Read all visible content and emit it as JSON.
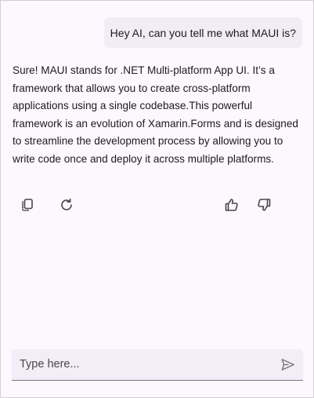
{
  "conversation": {
    "user_message": "Hey AI, can you tell me what MAUI is?",
    "ai_message": "Sure! MAUI stands for .NET Multi-platform App UI. It’s a framework that allows you to create cross-platform applications using a single codebase.This powerful framework is an evolution of Xamarin.Forms and is designed to streamline the development process by allowing you to write code once and deploy it across multiple platforms."
  },
  "actions": {
    "icons": [
      "copy-icon",
      "regenerate-icon",
      "thumbs-up-icon",
      "thumbs-down-icon"
    ]
  },
  "composer": {
    "placeholder": "Type here...",
    "value": "",
    "send_icon": "send-icon"
  },
  "colors": {
    "background": "#fdf8fd",
    "user_bubble": "#f1ecf6",
    "input_background": "#f2edf7",
    "icon": "#49454f"
  }
}
